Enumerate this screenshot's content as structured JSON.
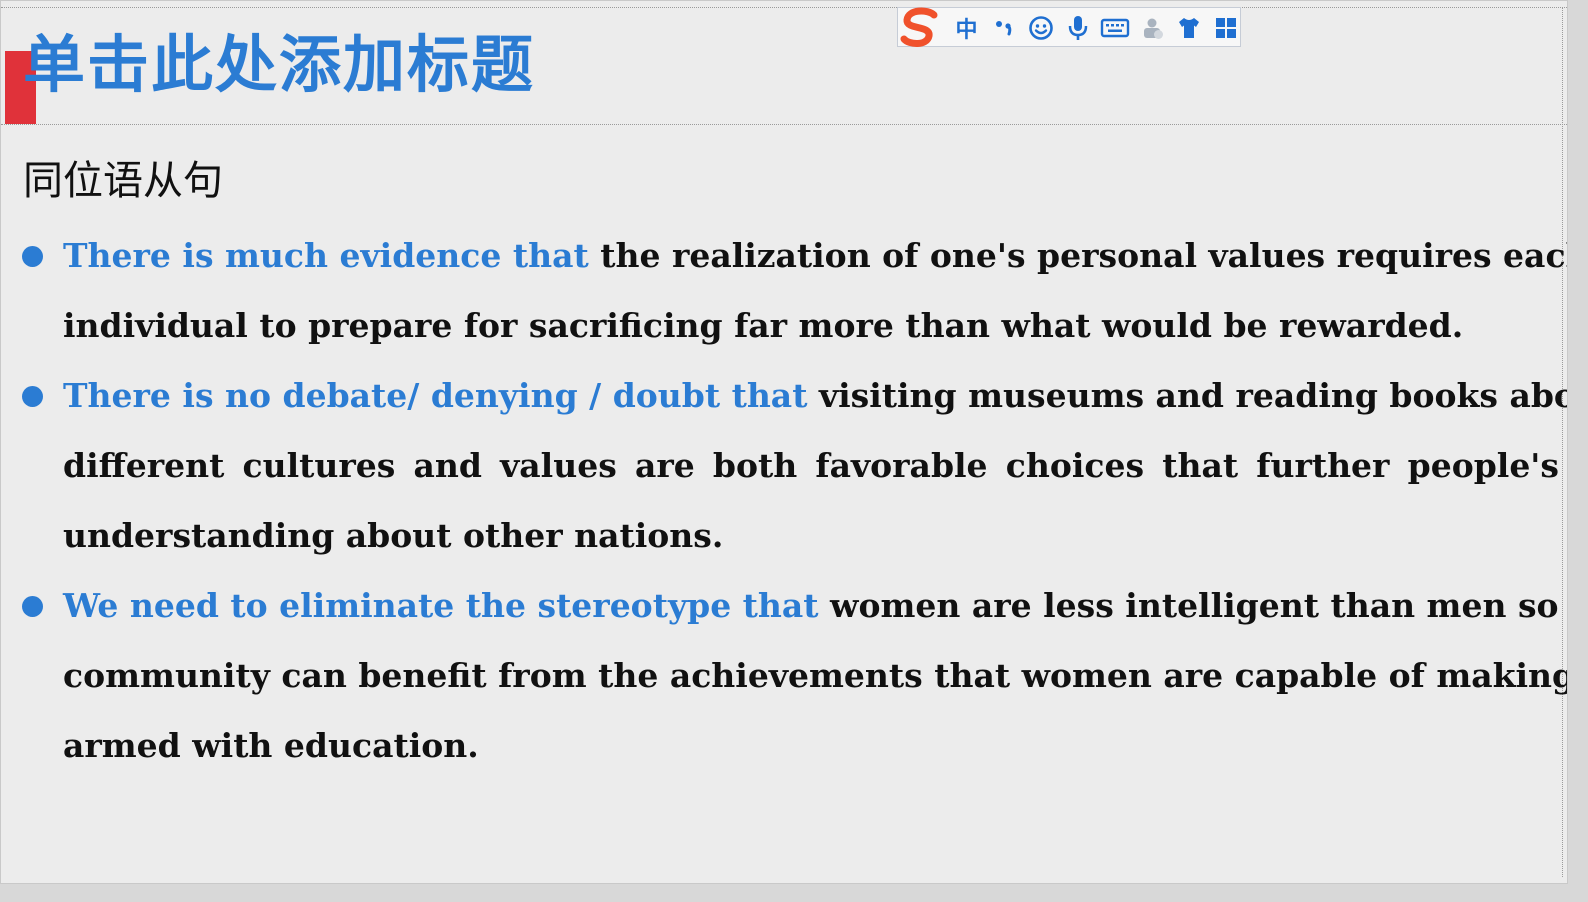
{
  "slide": {
    "title": "单击此处添加标题",
    "subtitle": "同位语从句"
  },
  "colors": {
    "title": "#2b7cd3",
    "accent_bar": "#e0323a",
    "highlight": "#2b7cd3",
    "bullet_dot": "#2b7cd3",
    "body_text": "#111111",
    "ime_logo": "#f0512b",
    "ime_icons": "#1f6fd1"
  },
  "bullets": [
    {
      "highlight": "There is much evidence that",
      "line1_rest": "the realization of one's personal values requires each",
      "lines": [
        "individual to prepare for sacrificing far more than what would be rewarded."
      ]
    },
    {
      "highlight": "There is no debate/ denying / doubt that",
      "line1_rest": "visiting museums and reading books about",
      "lines": [
        "different cultures and values are both favorable choices that further people's",
        "understanding about other nations."
      ]
    },
    {
      "highlight": "We need to eliminate the stereotype that",
      "line1_rest": "women are less intelligent than men so that our",
      "lines": [
        "community can benefit from the achievements that women are capable of making when",
        "armed with education."
      ]
    }
  ],
  "ime_toolbar": {
    "logo": "S",
    "mode_label": "中",
    "icons": [
      "punctuation-icon",
      "emoji-icon",
      "microphone-icon",
      "keyboard-icon",
      "toolbox-icon",
      "skin-icon",
      "menu-grid-icon"
    ]
  }
}
